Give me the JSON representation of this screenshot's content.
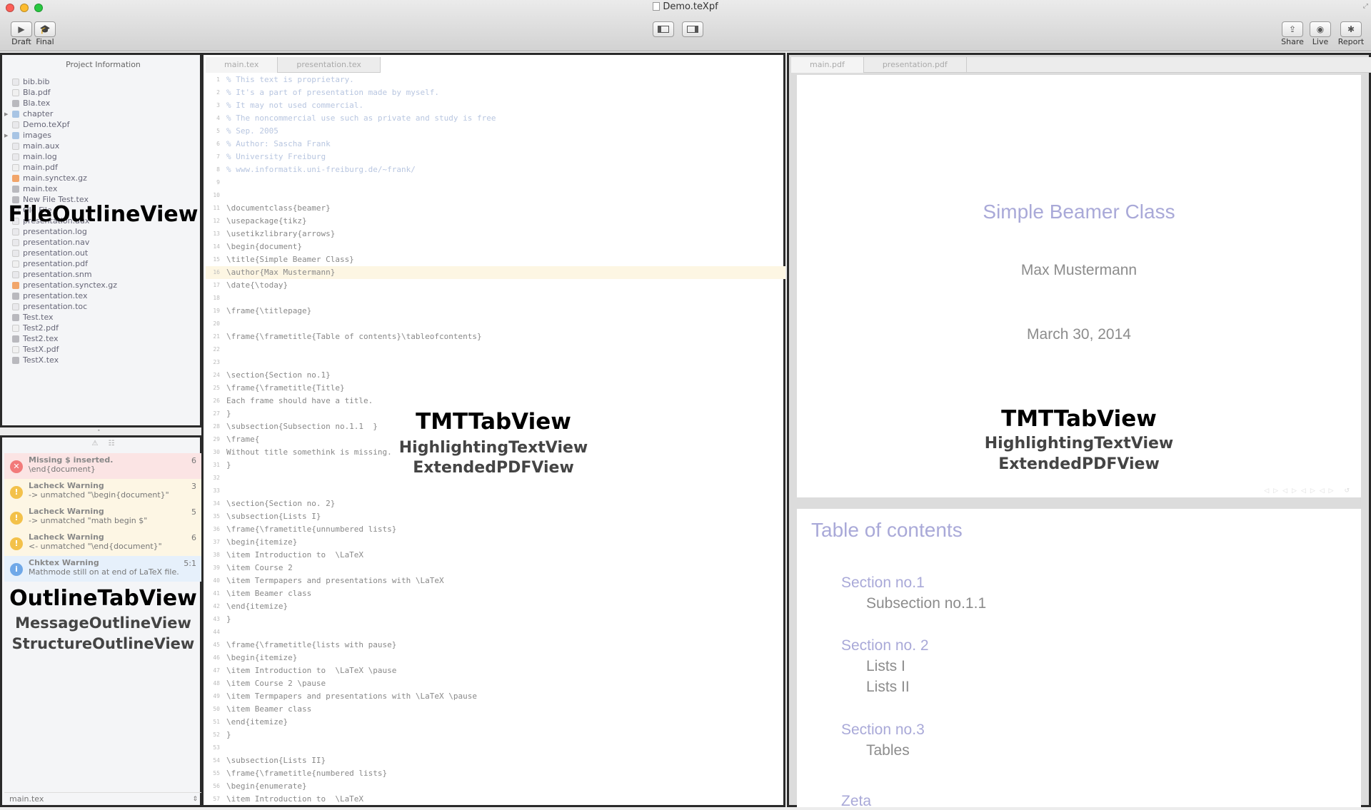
{
  "window": {
    "title": "Demo.teXpf"
  },
  "toolbar": {
    "draft_label": "Draft",
    "final_label": "Final",
    "share_label": "Share",
    "live_label": "Live",
    "report_label": "Report"
  },
  "project": {
    "header": "Project Information",
    "files": [
      {
        "name": "bib.bib",
        "kind": "file"
      },
      {
        "name": "Bla.pdf",
        "kind": "pdf"
      },
      {
        "name": "Bla.tex",
        "kind": "tex"
      },
      {
        "name": "chapter",
        "kind": "folder"
      },
      {
        "name": "Demo.teXpf",
        "kind": "file"
      },
      {
        "name": "images",
        "kind": "folder"
      },
      {
        "name": "main.aux",
        "kind": "file"
      },
      {
        "name": "main.log",
        "kind": "file"
      },
      {
        "name": "main.pdf",
        "kind": "pdf"
      },
      {
        "name": "main.synctex.gz",
        "kind": "gz"
      },
      {
        "name": "main.tex",
        "kind": "tex"
      },
      {
        "name": "New File Test.tex",
        "kind": "tex"
      },
      {
        "name": "Old File",
        "kind": "file"
      },
      {
        "name": "presentation.aux",
        "kind": "file"
      },
      {
        "name": "presentation.log",
        "kind": "file"
      },
      {
        "name": "presentation.nav",
        "kind": "file"
      },
      {
        "name": "presentation.out",
        "kind": "file"
      },
      {
        "name": "presentation.pdf",
        "kind": "pdf"
      },
      {
        "name": "presentation.snm",
        "kind": "file"
      },
      {
        "name": "presentation.synctex.gz",
        "kind": "gz"
      },
      {
        "name": "presentation.tex",
        "kind": "tex"
      },
      {
        "name": "presentation.toc",
        "kind": "file"
      },
      {
        "name": "Test.tex",
        "kind": "tex"
      },
      {
        "name": "Test2.pdf",
        "kind": "pdf"
      },
      {
        "name": "Test2.tex",
        "kind": "tex"
      },
      {
        "name": "TestX.pdf",
        "kind": "pdf"
      },
      {
        "name": "TestX.tex",
        "kind": "tex"
      }
    ]
  },
  "overlays": {
    "file_outline": "FileOutlineView",
    "outline_tab": "OutlineTabView",
    "message_outline": "MessageOutlineView",
    "structure_outline": "StructureOutlineView",
    "tmt_tab": "TMTTabView",
    "highlighting": "HighlightingTextView",
    "extended_pdf": "ExtendedPDFView"
  },
  "messages": [
    {
      "title": "Missing $ inserted.",
      "detail": "\\end{document}",
      "count": "6",
      "type": "error",
      "color": "#f27a7a",
      "bg": "#fbe4e4"
    },
    {
      "title": "Lacheck Warning",
      "detail": "-> unmatched \"\\begin{document}\"",
      "count": "3",
      "type": "warning",
      "color": "#f3c14a",
      "bg": "#fdf6e4"
    },
    {
      "title": "Lacheck Warning",
      "detail": "-> unmatched \"math begin $\"",
      "count": "5",
      "type": "warning",
      "color": "#f3c14a",
      "bg": "#fdf6e4"
    },
    {
      "title": "Lacheck Warning",
      "detail": "<- unmatched \"\\end{document}\"",
      "count": "6",
      "type": "warning",
      "color": "#f3c14a",
      "bg": "#fdf6e4"
    },
    {
      "title": "Chktex Warning",
      "detail": "Mathmode still on at end of LaTeX file.",
      "count": "5:1",
      "type": "info",
      "color": "#6fa8e8",
      "bg": "#e6f0fb"
    }
  ],
  "status": {
    "current_file": "main.tex"
  },
  "editor": {
    "tabs": [
      "main.tex",
      "presentation.tex"
    ],
    "lines": [
      {
        "n": "1",
        "text": "% This text is proprietary.",
        "style": "comment"
      },
      {
        "n": "2",
        "text": "% It's a part of presentation made by myself.",
        "style": "comment"
      },
      {
        "n": "3",
        "text": "% It may not used commercial.",
        "style": "comment"
      },
      {
        "n": "4",
        "text": "% The noncommercial use such as private and study is free",
        "style": "comment"
      },
      {
        "n": "5",
        "text": "% Sep. 2005",
        "style": "comment"
      },
      {
        "n": "6",
        "text": "% Author: Sascha Frank",
        "style": "comment"
      },
      {
        "n": "7",
        "text": "% University Freiburg",
        "style": "comment"
      },
      {
        "n": "8",
        "text": "% www.informatik.uni-freiburg.de/~frank/",
        "style": "comment"
      },
      {
        "n": "9",
        "text": "",
        "style": ""
      },
      {
        "n": "10",
        "text": "",
        "style": ""
      },
      {
        "n": "11",
        "text": "\\documentclass{beamer}",
        "style": ""
      },
      {
        "n": "12",
        "text": "\\usepackage{tikz}",
        "style": ""
      },
      {
        "n": "13",
        "text": "\\usetikzlibrary{arrows}",
        "style": ""
      },
      {
        "n": "14",
        "text": "\\begin{document}",
        "style": ""
      },
      {
        "n": "15",
        "text": "\\title{Simple Beamer Class}",
        "style": ""
      },
      {
        "n": "16",
        "text": "\\author{Max Mustermann}",
        "style": "hl"
      },
      {
        "n": "17",
        "text": "\\date{\\today}",
        "style": ""
      },
      {
        "n": "18",
        "text": "",
        "style": ""
      },
      {
        "n": "19",
        "text": "\\frame{\\titlepage}",
        "style": ""
      },
      {
        "n": "20",
        "text": "",
        "style": ""
      },
      {
        "n": "21",
        "text": "\\frame{\\frametitle{Table of contents}\\tableofcontents}",
        "style": ""
      },
      {
        "n": "22",
        "text": "",
        "style": ""
      },
      {
        "n": "23",
        "text": "",
        "style": ""
      },
      {
        "n": "24",
        "text": "\\section{Section no.1}",
        "style": ""
      },
      {
        "n": "25",
        "text": "\\frame{\\frametitle{Title}",
        "style": ""
      },
      {
        "n": "26",
        "text": "Each frame should have a title.",
        "style": ""
      },
      {
        "n": "27",
        "text": "}",
        "style": ""
      },
      {
        "n": "28",
        "text": "\\subsection{Subsection no.1.1  }",
        "style": ""
      },
      {
        "n": "29",
        "text": "\\frame{",
        "style": ""
      },
      {
        "n": "30",
        "text": "Without title somethink is missing.",
        "style": ""
      },
      {
        "n": "31",
        "text": "}",
        "style": ""
      },
      {
        "n": "32",
        "text": "",
        "style": ""
      },
      {
        "n": "33",
        "text": "",
        "style": ""
      },
      {
        "n": "34",
        "text": "\\section{Section no. 2}",
        "style": ""
      },
      {
        "n": "35",
        "text": "\\subsection{Lists I}",
        "style": ""
      },
      {
        "n": "36",
        "text": "\\frame{\\frametitle{unnumbered lists}",
        "style": ""
      },
      {
        "n": "37",
        "text": "\\begin{itemize}",
        "style": ""
      },
      {
        "n": "38",
        "text": "\\item Introduction to  \\LaTeX",
        "style": ""
      },
      {
        "n": "39",
        "text": "\\item Course 2",
        "style": ""
      },
      {
        "n": "40",
        "text": "\\item Termpapers and presentations with \\LaTeX",
        "style": ""
      },
      {
        "n": "41",
        "text": "\\item Beamer class",
        "style": ""
      },
      {
        "n": "42",
        "text": "\\end{itemize}",
        "style": ""
      },
      {
        "n": "43",
        "text": "}",
        "style": ""
      },
      {
        "n": "44",
        "text": "",
        "style": ""
      },
      {
        "n": "45",
        "text": "\\frame{\\frametitle{lists with pause}",
        "style": ""
      },
      {
        "n": "46",
        "text": "\\begin{itemize}",
        "style": ""
      },
      {
        "n": "47",
        "text": "\\item Introduction to  \\LaTeX \\pause",
        "style": ""
      },
      {
        "n": "48",
        "text": "\\item Course 2 \\pause",
        "style": ""
      },
      {
        "n": "49",
        "text": "\\item Termpapers and presentations with \\LaTeX \\pause",
        "style": ""
      },
      {
        "n": "50",
        "text": "\\item Beamer class",
        "style": ""
      },
      {
        "n": "51",
        "text": "\\end{itemize}",
        "style": ""
      },
      {
        "n": "52",
        "text": "}",
        "style": ""
      },
      {
        "n": "53",
        "text": "",
        "style": ""
      },
      {
        "n": "54",
        "text": "\\subsection{Lists II}",
        "style": ""
      },
      {
        "n": "55",
        "text": "\\frame{\\frametitle{numbered lists}",
        "style": ""
      },
      {
        "n": "56",
        "text": "\\begin{enumerate}",
        "style": ""
      },
      {
        "n": "57",
        "text": "\\item Introduction to  \\LaTeX",
        "style": ""
      }
    ]
  },
  "preview": {
    "tabs": [
      "main.pdf",
      "presentation.pdf"
    ],
    "slide1": {
      "title": "Simple Beamer Class",
      "author": "Max Mustermann",
      "date": "March 30, 2014"
    },
    "slide2": {
      "title": "Table of contents",
      "sec1": "Section no.1",
      "sub11": "Subsection no.1.1",
      "sec2": "Section no. 2",
      "sub21": "Lists I",
      "sub22": "Lists II",
      "sec3": "Section no.3",
      "sub31": "Tables",
      "sec4": "Zeta"
    },
    "title_color": "#a9a9d8",
    "text_color": "#8c8c8c"
  }
}
